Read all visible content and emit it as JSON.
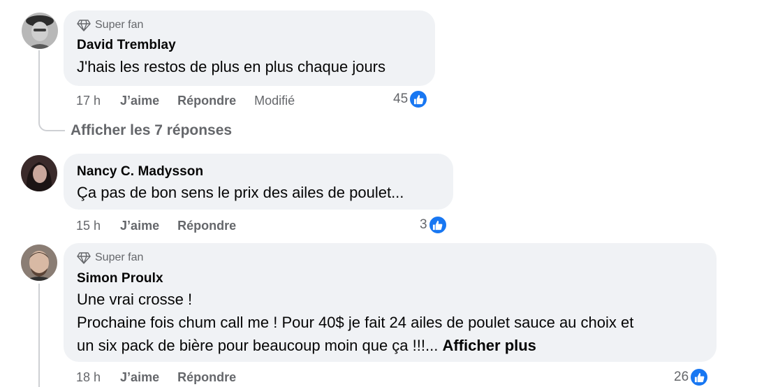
{
  "comments": [
    {
      "badge": "Super fan",
      "author": "David Tremblay",
      "text_lines": [
        "J'hais les restos de plus en plus chaque jours"
      ],
      "time": "17 h",
      "like_label": "J’aime",
      "reply_label": "Répondre",
      "edited": "Modifié",
      "reactions": "45",
      "view_replies": "Afficher les 7 réponses"
    },
    {
      "author": "Nancy C. Madysson",
      "text_lines": [
        "Ça pas de bon sens le prix des ailes de poulet..."
      ],
      "time": "15 h",
      "like_label": "J’aime",
      "reply_label": "Répondre",
      "reactions": "3"
    },
    {
      "badge": "Super fan",
      "author": "Simon Proulx",
      "text_lines": [
        "Une vrai crosse !",
        "Prochaine fois chum call me ! Pour 40$ je fait 24 ailes de poulet sauce au choix et",
        "un six pack de bière pour beaucoup moin que ça !!!..."
      ],
      "see_more": "Afficher plus",
      "time": "18 h",
      "like_label": "J’aime",
      "reply_label": "Répondre",
      "reactions": "26"
    }
  ],
  "icons": {
    "badge": "diamond-icon",
    "reaction": "thumbs-up-icon"
  },
  "colors": {
    "bubble": "#f0f2f5",
    "secondary_text": "#65676b",
    "like_blue": "#1877f2",
    "thread_line": "#ced0d4"
  }
}
